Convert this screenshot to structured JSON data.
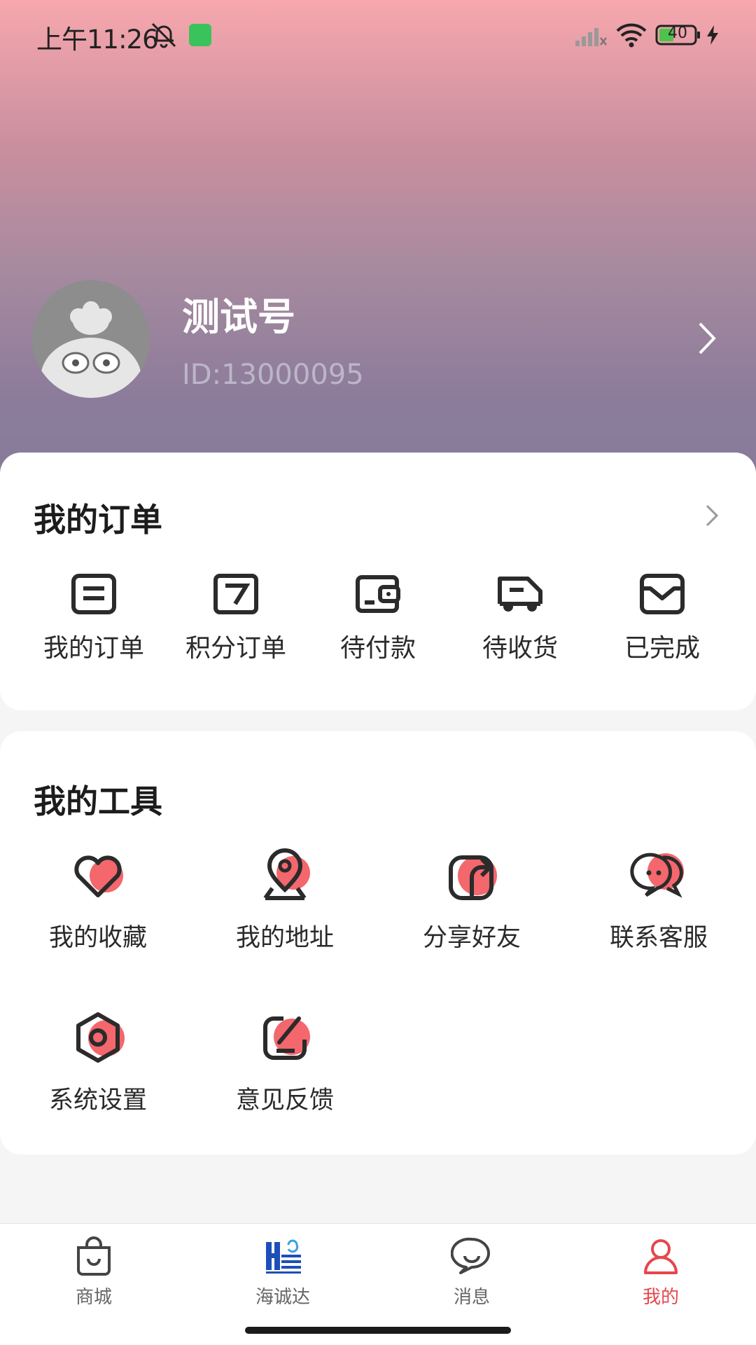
{
  "status_bar": {
    "time": "上午11:26",
    "battery": "40"
  },
  "profile": {
    "name": "测试号",
    "id": "ID:13000095"
  },
  "orders": {
    "title": "我的订单",
    "items": [
      {
        "label": "我的订单",
        "icon": "order-list-icon"
      },
      {
        "label": "积分订单",
        "icon": "points-order-icon"
      },
      {
        "label": "待付款",
        "icon": "wallet-icon"
      },
      {
        "label": "待收货",
        "icon": "delivery-truck-icon"
      },
      {
        "label": "已完成",
        "icon": "completed-box-icon"
      }
    ]
  },
  "tools": {
    "title": "我的工具",
    "items": [
      {
        "label": "我的收藏",
        "icon": "heart-icon"
      },
      {
        "label": "我的地址",
        "icon": "location-pin-icon"
      },
      {
        "label": "分享好友",
        "icon": "share-icon"
      },
      {
        "label": "联系客服",
        "icon": "chat-service-icon"
      },
      {
        "label": "系统设置",
        "icon": "settings-icon"
      },
      {
        "label": "意见反馈",
        "icon": "feedback-edit-icon"
      }
    ]
  },
  "tab_bar": {
    "tabs": [
      {
        "label": "商城",
        "icon": "shopping-bag-icon",
        "active": false
      },
      {
        "label": "海诚达",
        "icon": "brand-logo-icon",
        "active": false
      },
      {
        "label": "消息",
        "icon": "message-bubble-icon",
        "active": false
      },
      {
        "label": "我的",
        "icon": "user-icon",
        "active": true
      }
    ]
  },
  "colors": {
    "accent": "#e5484d",
    "icon_accent": "#f0525a",
    "header_top": "#f7a7ad",
    "header_bottom": "#857b9a",
    "brand_blue": "#1d4fb8"
  }
}
